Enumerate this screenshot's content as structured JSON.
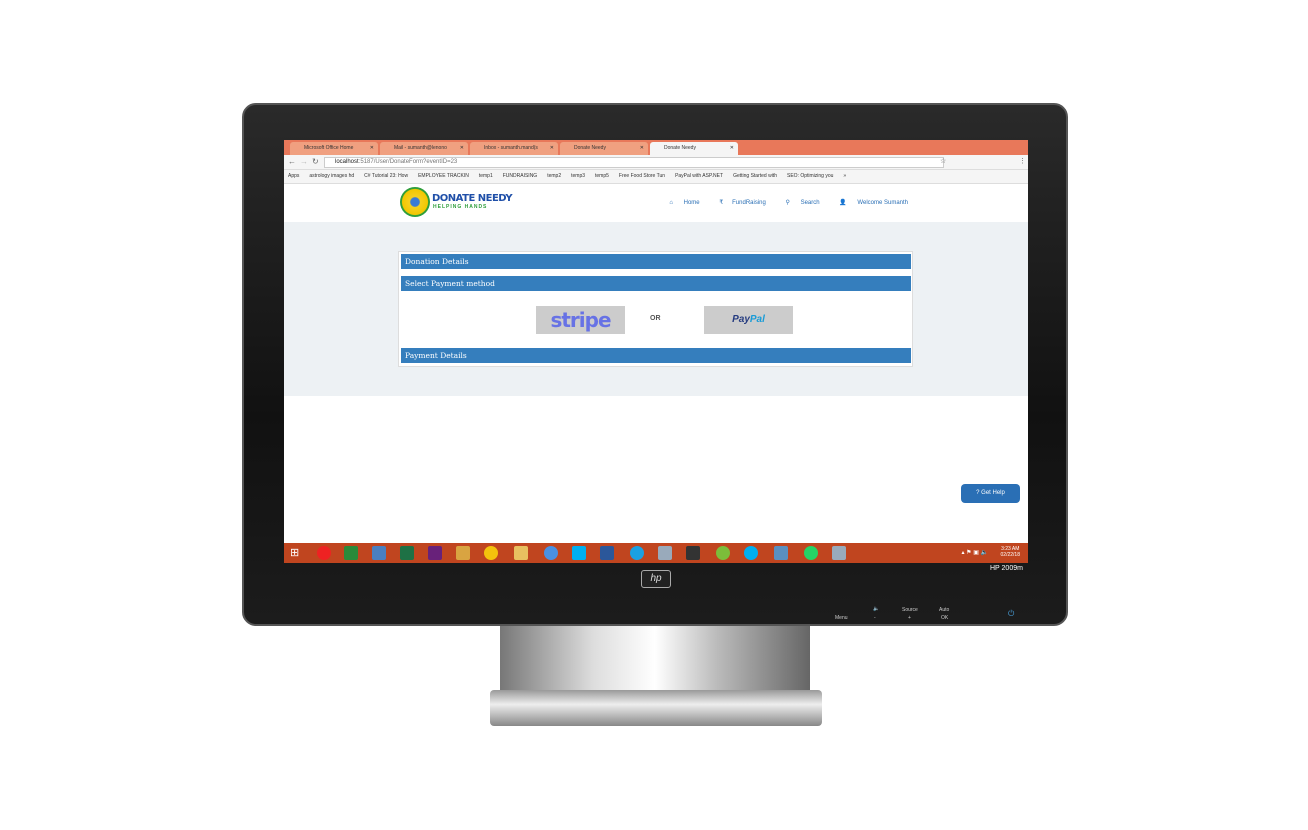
{
  "browser": {
    "tabs": [
      {
        "label": "Microsoft Office Home"
      },
      {
        "label": "Mail - sumanth@lenono"
      },
      {
        "label": "Inbox - sumanth.mand(s"
      },
      {
        "label": "Donate Needy"
      },
      {
        "label": "Donate Needy"
      }
    ],
    "url_host": "localhost",
    "url_path": ":5187/User/DonateForm?eventID=23",
    "bookmarks": [
      "Apps",
      "astrology images hd",
      "C# Tutorial 23: How",
      "EMPLOYEE TRACKIN",
      "temp1",
      "FUNDRAISING",
      "temp2",
      "temp3",
      "temp5",
      "Free Food Store Tun",
      "PayPal with ASP.NET",
      "Getting Started with",
      "SEO: Optimizing you",
      "»"
    ]
  },
  "site": {
    "brand": "DONATE NEEDY",
    "tagline": "HELPING HANDS",
    "nav": [
      "Home",
      "FundRaising",
      "Search",
      "Welcome Sumanth"
    ],
    "sections": {
      "donation": "Donation Details",
      "method": "Select Payment method",
      "payment": "Payment Details"
    },
    "stripe": "stripe",
    "or": "OR",
    "paypal_a": "Pay",
    "paypal_b": "Pal",
    "help": "Get Help"
  },
  "taskbar": {
    "time": "3:23 AM",
    "date": "02/22/18"
  },
  "monitor": {
    "model": "HP 2009m",
    "logo": "hp",
    "controls": [
      "Menu",
      "Source",
      "Auto",
      "-",
      "+",
      "OK"
    ]
  }
}
